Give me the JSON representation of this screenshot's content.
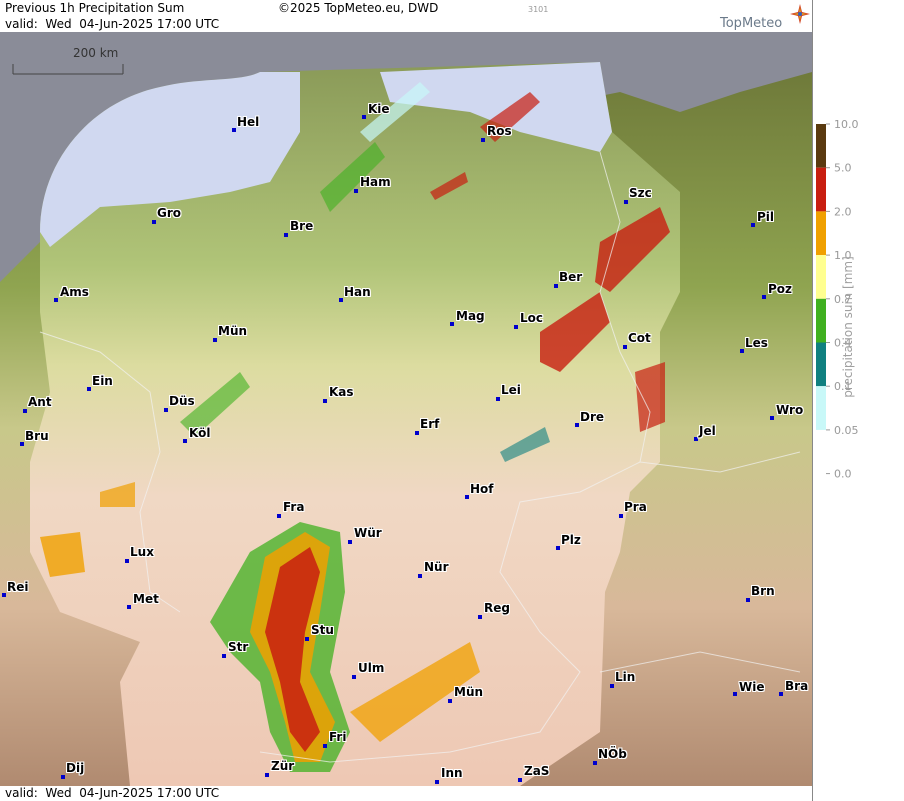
{
  "header": {
    "title": "Previous 1h Precipitation Sum",
    "valid": "valid:  Wed  04-Jun-2025 17:00 UTC",
    "copyright": "©2025 TopMeteo.eu, DWD",
    "image_code": "3101",
    "logo": "TopMeteo",
    "logo_icon": "compass-star-icon"
  },
  "footer": {
    "valid": "valid:  Wed  04-Jun-2025 17:00 UTC"
  },
  "scale": {
    "label": "200 km"
  },
  "legend": {
    "title": "precipitation sum [mm]",
    "levels": [
      {
        "label": "10.0",
        "color": "#5a3a10"
      },
      {
        "label": "5.0",
        "color": "#c81e10"
      },
      {
        "label": "2.0",
        "color": "#f0a000"
      },
      {
        "label": "1.0",
        "color": "#ffff90"
      },
      {
        "label": "0.7",
        "color": "#40b020"
      },
      {
        "label": "0.4",
        "color": "#108080"
      },
      {
        "label": "0.1",
        "color": "#c8f8f8"
      },
      {
        "label": "0.05",
        "color": "#ffffff"
      },
      {
        "label": "0.0",
        "color": "#ffffff"
      }
    ]
  },
  "cities": [
    {
      "name": "Kie"
    },
    {
      "name": "Hel"
    },
    {
      "name": "Ros"
    },
    {
      "name": "Ham"
    },
    {
      "name": "Szc"
    },
    {
      "name": "Gro"
    },
    {
      "name": "Bre"
    },
    {
      "name": "Pil"
    },
    {
      "name": "Ber"
    },
    {
      "name": "Ams"
    },
    {
      "name": "Han"
    },
    {
      "name": "Poz"
    },
    {
      "name": "Mag"
    },
    {
      "name": "Loc"
    },
    {
      "name": "Mün"
    },
    {
      "name": "Cot"
    },
    {
      "name": "Les"
    },
    {
      "name": "Ein"
    },
    {
      "name": "Kas"
    },
    {
      "name": "Lei"
    },
    {
      "name": "Ant"
    },
    {
      "name": "Düs"
    },
    {
      "name": "Wro"
    },
    {
      "name": "Dre"
    },
    {
      "name": "Erf"
    },
    {
      "name": "Bru"
    },
    {
      "name": "Köl"
    },
    {
      "name": "Jel"
    },
    {
      "name": "Hof"
    },
    {
      "name": "Fra"
    },
    {
      "name": "Pra"
    },
    {
      "name": "Wür"
    },
    {
      "name": "Plz"
    },
    {
      "name": "Lux"
    },
    {
      "name": "Nür"
    },
    {
      "name": "Rei"
    },
    {
      "name": "Met"
    },
    {
      "name": "Brn"
    },
    {
      "name": "Reg"
    },
    {
      "name": "Stu"
    },
    {
      "name": "Str"
    },
    {
      "name": "Ulm"
    },
    {
      "name": "Lin"
    },
    {
      "name": "Mün"
    },
    {
      "name": "Wie"
    },
    {
      "name": "Bra"
    },
    {
      "name": "Fri"
    },
    {
      "name": "NÖb"
    },
    {
      "name": "Dij"
    },
    {
      "name": "Zür"
    },
    {
      "name": "Inn"
    },
    {
      "name": "ZaS"
    }
  ]
}
